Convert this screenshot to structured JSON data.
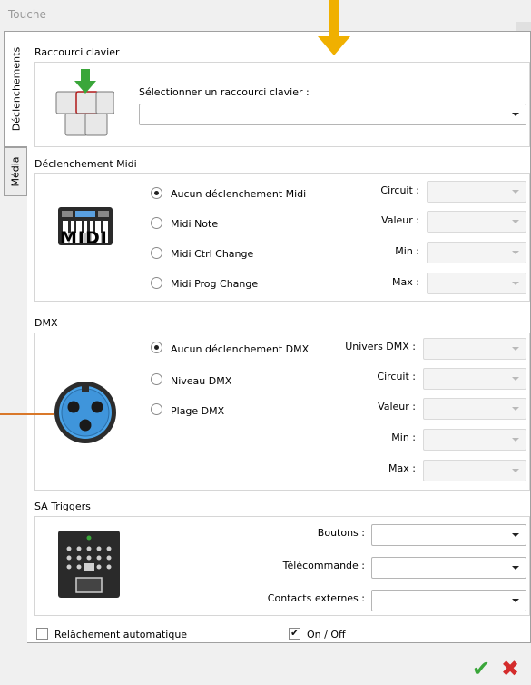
{
  "window": {
    "title": "Touche"
  },
  "tabs": [
    "Déclenchements",
    "Média"
  ],
  "keyboard": {
    "section_title": "Raccourci clavier",
    "select_label": "Sélectionner un raccourci clavier :",
    "select_value": ""
  },
  "midi": {
    "section_title": "Déclenchement Midi",
    "logo_text": "MIDI",
    "options": [
      "Aucun déclenchement Midi",
      "Midi Note",
      "Midi Ctrl Change",
      "Midi Prog Change"
    ],
    "selected": "Aucun déclenchement Midi",
    "fields": [
      "Circuit :",
      "Valeur :",
      "Min :",
      "Max :"
    ]
  },
  "dmx": {
    "section_title": "DMX",
    "options": [
      "Aucun déclenchement DMX",
      "Niveau DMX",
      "Plage DMX"
    ],
    "selected": "Aucun déclenchement DMX",
    "fields": [
      "Univers DMX :",
      "Circuit :",
      "Valeur :",
      "Min :",
      "Max :"
    ]
  },
  "sa_triggers": {
    "section_title": "SA Triggers",
    "fields": [
      "Boutons :",
      "Télécommande :",
      "Contacts externes :"
    ]
  },
  "footer": {
    "auto_release_label": "Relâchement automatique",
    "auto_release_checked": false,
    "onoff_label": "On / Off",
    "onoff_checked": true
  },
  "colors": {
    "annotation_arrow": "#f0b000",
    "annotation_line": "#d9782a",
    "ok": "#3aa63a",
    "cancel": "#d42c2c"
  }
}
